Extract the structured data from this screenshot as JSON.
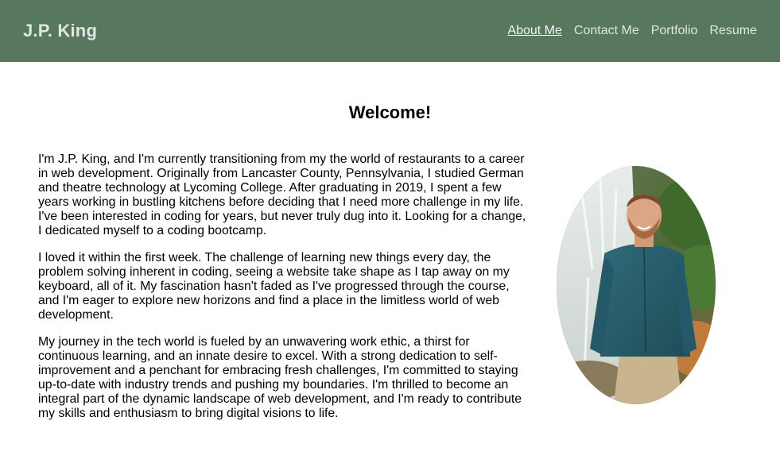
{
  "header": {
    "brand": "J.P. King",
    "nav": [
      {
        "label": "About Me",
        "active": true
      },
      {
        "label": "Contact Me",
        "active": false
      },
      {
        "label": "Portfolio",
        "active": false
      },
      {
        "label": "Resume",
        "active": false
      }
    ]
  },
  "main": {
    "title": "Welcome!",
    "paragraphs": [
      "I'm J.P. King, and I'm currently transitioning from my the world of restaurants to a career in web development. Originally from Lancaster County, Pennsylvania, I studied German and theatre technology at Lycoming College. After graduating in 2019, I spent a few years working in bustling kitchens before deciding that I need more challenge in my life. I've been interested in coding for years, but never truly dug into it. Looking for a change, I dedicated myself to a coding bootcamp.",
      "I loved it within the first week. The challenge of learning new things every day, the problem solving inherent in coding, seeing a website take shape as I tap away on my keyboard, all of it. My fascination hasn't faded as I've progressed through the course, and I'm eager to explore new horizons and find a place in the limitless world of web development.",
      "My journey in the tech world is fueled by an unwavering work ethic, a thirst for continuous learning, and an innate desire to excel. With a strong dedication to self-improvement and a penchant for embracing fresh challenges, I'm committed to staying up-to-date with industry trends and pushing my boundaries. I'm thrilled to become an integral part of the dynamic landscape of web development, and I'm ready to contribute my skills and enthusiasm to bring digital visions to life."
    ]
  },
  "colors": {
    "header_bg": "#58775f",
    "nav_text": "#dfe7e1",
    "body_bg": "#ffffff"
  }
}
